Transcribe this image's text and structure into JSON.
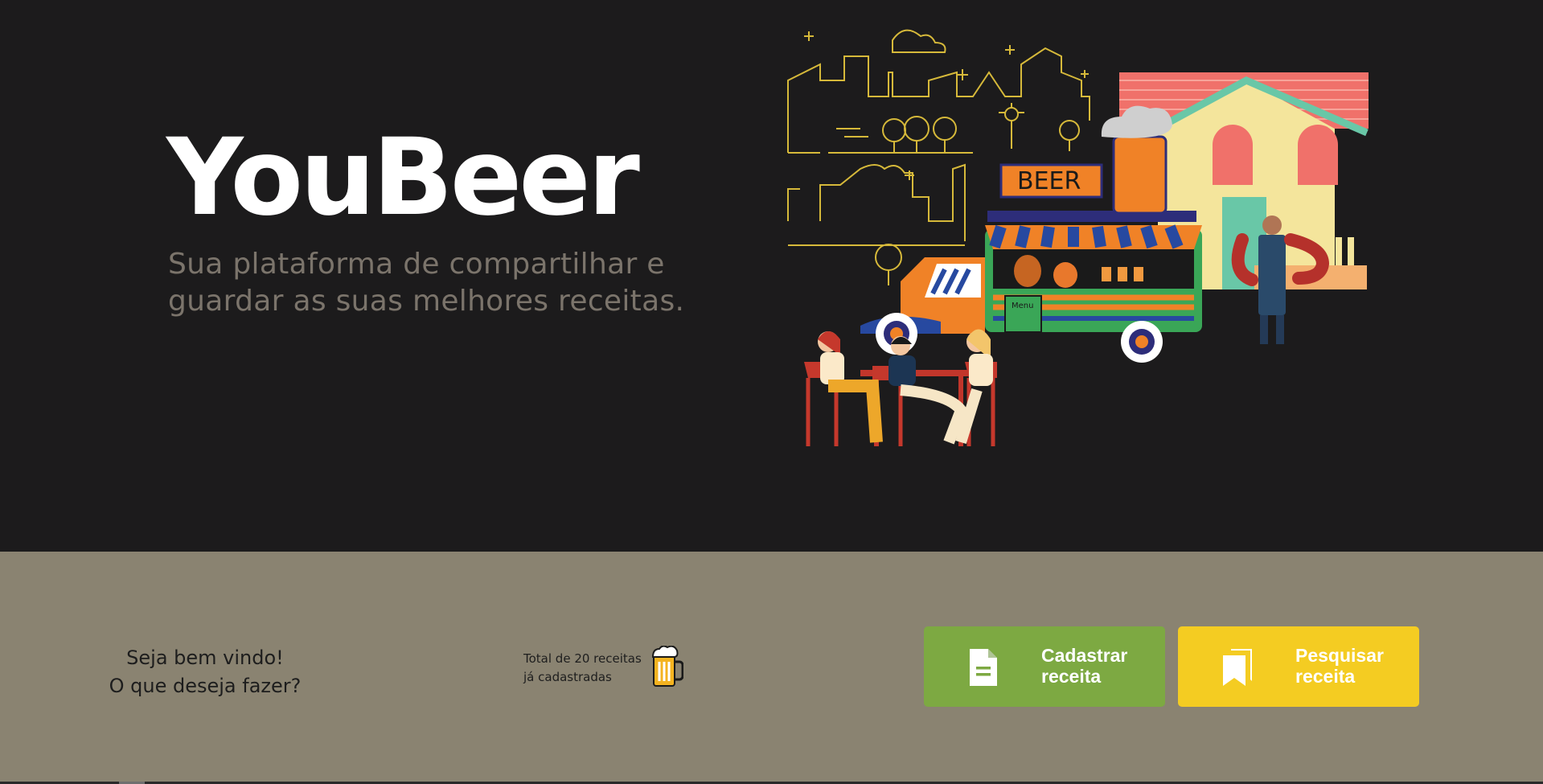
{
  "hero": {
    "brand": "YouBeer",
    "tagline_line1": "Sua plataforma de compartilhar e",
    "tagline_line2": "guardar as suas melhores receitas.",
    "illustration": {
      "icon": "beer-food-truck-illustration",
      "sign_text": "BEER",
      "menu_text": "Menu"
    },
    "background": "#1c1b1c"
  },
  "panel": {
    "background": "#8a8371",
    "welcome_line1": "Seja bem vindo!",
    "welcome_line2": "O que deseja fazer?",
    "total_line1": "Total de 20 receitas",
    "total_line2": "já cadastradas",
    "total_icon": "beer-mug-icon",
    "actions": [
      {
        "line1": "Cadastrar",
        "line2": "receita",
        "icon": "document-icon",
        "color": "#7da942"
      },
      {
        "line1": "Pesquisar",
        "line2": "receita",
        "icon": "bookmarks-icon",
        "color": "#f4cc22"
      }
    ]
  }
}
